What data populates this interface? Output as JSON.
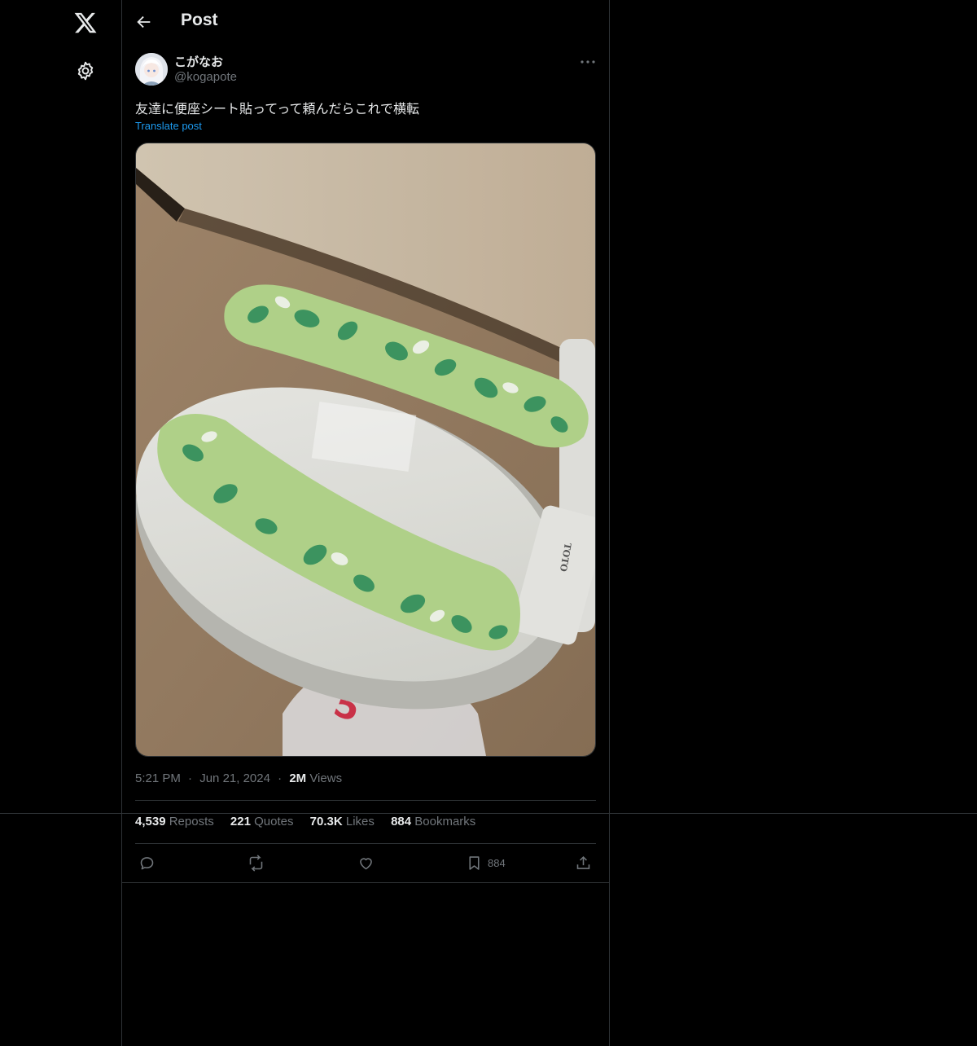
{
  "header": {
    "title": "Post"
  },
  "author": {
    "display_name": "こがなお",
    "handle": "@kogapote"
  },
  "post": {
    "text": "友達に便座シート貼ってって頼んだらこれで横転",
    "translate_label": "Translate post",
    "media_text": "TOTO"
  },
  "meta": {
    "time": "5:21 PM",
    "date": "Jun 21, 2024",
    "views_count": "2M",
    "views_label": "Views",
    "dot": "·"
  },
  "stats": [
    {
      "count": "4,539",
      "label": "Reposts"
    },
    {
      "count": "221",
      "label": "Quotes"
    },
    {
      "count": "70.3K",
      "label": "Likes"
    },
    {
      "count": "884",
      "label": "Bookmarks"
    }
  ],
  "actions": {
    "bookmark_count": "884"
  },
  "icons": [
    "x-logo-icon",
    "gear-icon",
    "back-arrow-icon",
    "more-dots-icon",
    "reply-icon",
    "repost-icon",
    "like-icon",
    "bookmark-icon",
    "share-icon"
  ],
  "colors": {
    "background": "#000000",
    "link": "#1d9bf0",
    "muted": "#71767b",
    "text": "#e7e9ea",
    "border": "#2f3336"
  }
}
